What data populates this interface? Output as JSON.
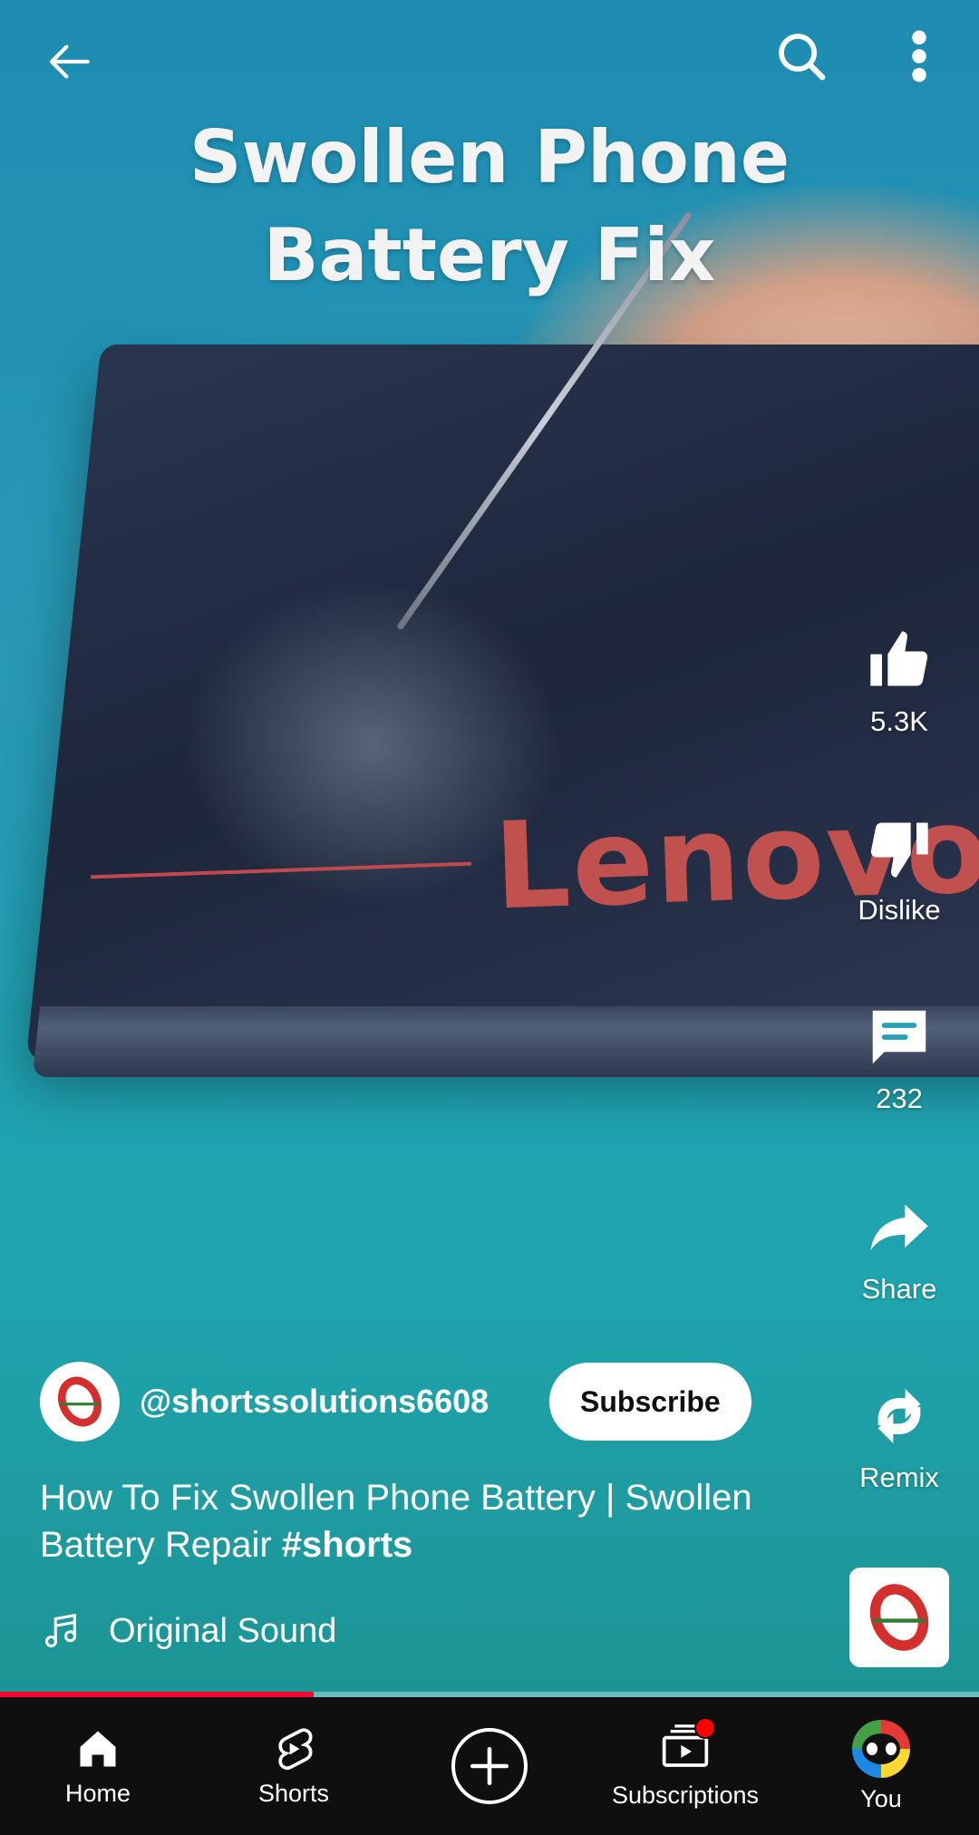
{
  "video": {
    "overlay_title_lines": [
      "Swollen Phone",
      "Battery Fix"
    ],
    "brand_print": "Lenovo"
  },
  "top_bar": {
    "back_icon": "arrow-left-icon",
    "search_icon": "search-icon",
    "more_icon": "more-vertical-icon"
  },
  "actions": {
    "like": {
      "icon": "thumbs-up-icon",
      "label": "5.3K"
    },
    "dislike": {
      "icon": "thumbs-down-icon",
      "label": "Dislike"
    },
    "comments": {
      "icon": "comment-icon",
      "label": "232"
    },
    "share": {
      "icon": "share-icon",
      "label": "Share"
    },
    "remix": {
      "icon": "remix-icon",
      "label": "Remix"
    }
  },
  "channel": {
    "handle": "@shortssolutions6608",
    "subscribe_label": "Subscribe"
  },
  "description": {
    "text": "How To Fix Swollen Phone Battery | Swollen Battery Repair ",
    "hashtag": "#shorts"
  },
  "sound": {
    "icon": "music-note-icon",
    "label": "Original Sound"
  },
  "progress": {
    "fraction": 0.32
  },
  "colors": {
    "accent": "#ff0033",
    "navbar_bg": "#0f0f0f",
    "notification": "#ff0000"
  },
  "nav": {
    "home": {
      "icon": "home-icon",
      "label": "Home"
    },
    "shorts": {
      "icon": "shorts-icon",
      "label": "Shorts"
    },
    "create": {
      "icon": "plus-circle-icon"
    },
    "subscriptions": {
      "icon": "subscriptions-icon",
      "label": "Subscriptions"
    },
    "you": {
      "icon": "avatar-icon",
      "label": "You"
    }
  }
}
